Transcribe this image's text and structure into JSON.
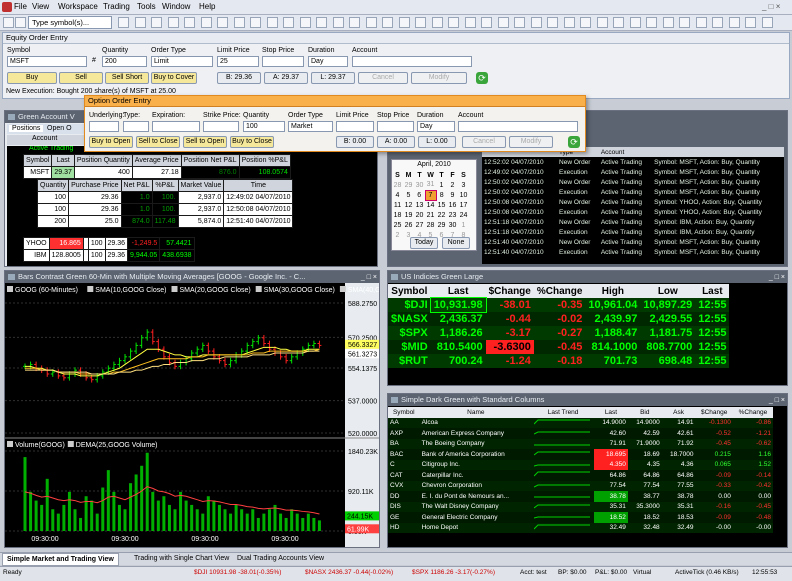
{
  "menu": {
    "items": [
      "File",
      "View",
      "Workspace",
      "Trading",
      "Tools",
      "Window",
      "Help"
    ],
    "symbol_combo": "Type symbol(s)..."
  },
  "equity": {
    "title": "Equity Order Entry",
    "labels": {
      "symbol": "Symbol",
      "quantity": "Quantity",
      "order_type": "Order Type",
      "limit_price": "Limit Price",
      "stop_price": "Stop Price",
      "duration": "Duration",
      "account": "Account"
    },
    "symbol": "MSFT",
    "quantity": "200",
    "order_type": "Limit",
    "limit_price": "25",
    "duration": "Day",
    "buttons": {
      "buy": "Buy",
      "sell": "Sell",
      "sell_short": "Sell Short",
      "buy_to_cover": "Buy to Cover",
      "cancel": "Cancel",
      "modify": "Modify"
    },
    "bid": "B: 29.36",
    "ask": "A: 29.37",
    "last": "L: 29.37",
    "status": "New Execution: Bought 200 share(s) of MSFT at 25.00"
  },
  "option": {
    "title": "Option Order Entry",
    "labels": {
      "underlying": "Underlying:",
      "type": "Type:",
      "expiration": "Expiration:",
      "strike": "Strike Price:",
      "quantity": "Quantity",
      "order_type": "Order Type",
      "limit_price": "Limit Price",
      "stop_price": "Stop Price",
      "duration": "Duration",
      "account": "Account"
    },
    "quantity": "100",
    "order_type": "Market",
    "duration": "Day",
    "buttons": {
      "buy_open": "Buy to Open",
      "sell_close": "Sell to Close",
      "sell_open": "Sell to Open",
      "buy_close": "Buy to Close",
      "cancel": "Cancel",
      "modify": "Modify"
    },
    "bid": "B: 0.00",
    "ask": "A: 0.00",
    "last": "L: 0.00"
  },
  "account": {
    "title": "Green Account V",
    "tabs": [
      "Positions",
      "Open O"
    ],
    "col_account": "Account",
    "active_row": "Active Trading",
    "headers": [
      "Symbol",
      "Last",
      "Position Quantity",
      "Average Price",
      "Position Net P&L",
      "Position %P&L"
    ],
    "msft": [
      "MSFT",
      "29.37",
      "400",
      "27.18",
      "876.0",
      "108.0574"
    ],
    "sub_headers": [
      "Quantity",
      "Purchase Price",
      "Net P&L",
      "%P&L",
      "Market Value",
      "Time"
    ],
    "sub_rows": [
      [
        "100",
        "29.36",
        "1.0",
        "100.",
        "2,937.0",
        "12:49:02 04/07/2010"
      ],
      [
        "100",
        "29.36",
        "1.0",
        "100.",
        "2,937.0",
        "12:50:08 04/07/2010"
      ],
      [
        "200",
        "25.0",
        "874.0",
        "117.48",
        "5,874.0",
        "12:51:40 04/07/2010"
      ]
    ],
    "yhoo": [
      "YHOO",
      "16.865",
      "",
      "100",
      "29.36",
      "-1,249.5",
      "57.4421"
    ],
    "ibm": [
      "IBM",
      "128.8005",
      "",
      "100",
      "29.36",
      "9,944.05",
      "438.6938"
    ]
  },
  "calendar": {
    "month": "April, 2010",
    "days": [
      "S",
      "M",
      "T",
      "W",
      "T",
      "F",
      "S"
    ],
    "weeks": [
      [
        "28",
        "29",
        "30",
        "31",
        "1",
        "2",
        "3"
      ],
      [
        "4",
        "5",
        "6",
        "7",
        "8",
        "9",
        "10"
      ],
      [
        "11",
        "12",
        "13",
        "14",
        "15",
        "16",
        "17"
      ],
      [
        "18",
        "19",
        "20",
        "21",
        "22",
        "23",
        "24"
      ],
      [
        "25",
        "26",
        "27",
        "28",
        "29",
        "30",
        "1"
      ],
      [
        "2",
        "3",
        "4",
        "5",
        "6",
        "7",
        "8"
      ]
    ],
    "today": "Today",
    "none": "None"
  },
  "messages": {
    "headers": [
      "",
      "Type",
      "Account",
      ""
    ],
    "rows": [
      [
        "12:52:02 04/07/2010",
        "New Order",
        "Active Trading",
        "Symbol: MSFT, Action: Buy, Quantity"
      ],
      [
        "12:49:02 04/07/2010",
        "Execution",
        "Active Trading",
        "Symbol: MSFT, Action: Buy, Quantity"
      ],
      [
        "12:50:02 04/07/2010",
        "New Order",
        "Active Trading",
        "Symbol: MSFT, Action: Buy, Quantity"
      ],
      [
        "12:50:02 04/07/2010",
        "Execution",
        "Active Trading",
        "Symbol: MSFT, Action: Buy, Quantity"
      ],
      [
        "12:50:08 04/07/2010",
        "New Order",
        "Active Trading",
        "Symbol: YHOO, Action: Buy, Quantity"
      ],
      [
        "12:50:08 04/07/2010",
        "Execution",
        "Active Trading",
        "Symbol: YHOO, Action: Buy, Quantity"
      ],
      [
        "12:51:18 04/07/2010",
        "New Order",
        "Active Trading",
        "Symbol: IBM, Action: Buy, Quantity"
      ],
      [
        "12:51:18 04/07/2010",
        "Execution",
        "Active Trading",
        "Symbol: IBM, Action: Buy, Quantity"
      ],
      [
        "12:51:40 04/07/2010",
        "New Order",
        "Active Trading",
        "Symbol: MSFT, Action: Buy, Quantity"
      ],
      [
        "12:51:40 04/07/2010",
        "Execution",
        "Active Trading",
        "Symbol: MSFT, Action: Buy, Quantity"
      ]
    ]
  },
  "chart": {
    "title": "Bars Contrast Green 60-Min with Multiple Moving Averages [GOOG - Google Inc. - C...",
    "legend": [
      "GOOG (60-Minutes)",
      "SMA(10,GOOG Close)",
      "SMA(20,GOOG Close)",
      "SMA(30,GOOG Close)",
      "SMA(40,G"
    ],
    "price_ticks": [
      "588.2750",
      "570.2500",
      "554.1375",
      "537.0000",
      "520.0000"
    ],
    "price_labels": [
      "566.3327",
      "561.3273"
    ],
    "vol_legend": [
      "Volume(GOOG)",
      "DEMA(25,GOOG Volume)"
    ],
    "vol_ticks": [
      "1840.23K",
      "920.11K",
      "0.00K"
    ],
    "vol_labels": [
      "244.15K",
      "61.99K"
    ],
    "time_labels": [
      "09:30:00",
      "09:30:00",
      "09:30:00",
      "09:30:00"
    ]
  },
  "chart_data": {
    "type": "bar",
    "title": "Bars Contrast Green 60-Min with Multiple Moving Averages [GOOG - Google Inc. - C...",
    "xlabel": "",
    "ylabel": "",
    "ylim": [
      520,
      588.275
    ],
    "x": [
      "09:30:00",
      "09:30:00",
      "09:30:00",
      "09:30:00"
    ],
    "series": [
      {
        "name": "GOOG (60-Minutes)",
        "values": [
          555,
          556,
          554,
          553,
          551,
          552,
          550,
          549,
          551,
          553,
          551,
          549,
          548,
          550,
          552,
          554,
          556,
          558,
          560,
          563,
          566,
          570,
          573,
          568,
          564,
          560,
          557,
          555,
          557,
          559,
          562,
          564,
          566,
          563,
          560,
          558,
          556,
          558,
          561,
          563,
          566,
          568,
          570,
          567,
          564,
          562,
          560,
          558,
          560,
          562,
          564,
          566,
          567,
          566
        ]
      },
      {
        "name": "SMA(10,GOOG Close)",
        "values": [
          555,
          555,
          554,
          554,
          553,
          553,
          552,
          551,
          551,
          551,
          550,
          550,
          550,
          550,
          551,
          552,
          553,
          554,
          556,
          558,
          560,
          562,
          564,
          564,
          564,
          563,
          562,
          561,
          561,
          560,
          560,
          560,
          561,
          561,
          561,
          561,
          561,
          561,
          561,
          561,
          562,
          563,
          564,
          565,
          565,
          565,
          564,
          564,
          563,
          563,
          563,
          564,
          564,
          564
        ]
      },
      {
        "name": "SMA(20,GOOG Close)",
        "values": [
          554,
          554,
          554,
          553,
          553,
          553,
          552,
          552,
          552,
          552,
          551,
          551,
          551,
          551,
          551,
          551,
          552,
          552,
          553,
          554,
          555,
          556,
          557,
          558,
          559,
          559,
          559,
          559,
          559,
          559,
          560,
          560,
          560,
          561,
          561,
          561,
          561,
          561,
          561,
          561,
          561,
          562,
          562,
          562,
          563,
          563,
          563,
          563,
          563,
          563,
          563,
          563,
          563,
          564
        ]
      },
      {
        "name": "SMA(30,GOOG Close)",
        "values": [
          553,
          553,
          553,
          553,
          553,
          553,
          552,
          552,
          552,
          552,
          552,
          552,
          551,
          551,
          551,
          551,
          551,
          552,
          552,
          552,
          553,
          553,
          554,
          555,
          555,
          556,
          556,
          557,
          557,
          557,
          558,
          558,
          558,
          559,
          559,
          559,
          560,
          560,
          560,
          560,
          560,
          561,
          561,
          561,
          561,
          562,
          562,
          562,
          562,
          562,
          562,
          563,
          563,
          563
        ]
      },
      {
        "name": "Volume(GOOG)",
        "values": [
          1700,
          900,
          700,
          600,
          1200,
          500,
          400,
          600,
          900,
          500,
          300,
          800,
          700,
          400,
          1000,
          1400,
          900,
          600,
          500,
          1100,
          1300,
          1500,
          1800,
          900,
          700,
          800,
          600,
          500,
          900,
          700,
          600,
          500,
          400,
          800,
          700,
          600,
          500,
          400,
          600,
          500,
          400,
          500,
          300,
          400,
          500,
          600,
          400,
          300,
          500,
          400,
          300,
          400,
          300,
          244
        ]
      },
      {
        "name": "DEMA(25,GOOG Volume)",
        "values": [
          900,
          870,
          820,
          780,
          800,
          760,
          720,
          700,
          720,
          700,
          660,
          680,
          680,
          650,
          700,
          780,
          800,
          760,
          720,
          780,
          840,
          920,
          1020,
          980,
          920,
          900,
          860,
          800,
          820,
          800,
          760,
          720,
          680,
          700,
          690,
          670,
          640,
          610,
          610,
          590,
          560,
          550,
          520,
          510,
          520,
          530,
          510,
          480,
          480,
          470,
          450,
          440,
          420,
          390
        ]
      }
    ]
  },
  "us": {
    "title": "US Indicies Green Large",
    "headers": [
      "Symbol",
      "Last",
      "$Change",
      "%Change",
      "High",
      "Low",
      "Last"
    ],
    "rows": [
      [
        "$DJI",
        "10,931.98",
        "-38.01",
        "-0.35",
        "10,961.04",
        "10,897.29",
        "12:55"
      ],
      [
        "$NASX",
        "2,436.37",
        "-0.44",
        "-0.02",
        "2,439.97",
        "2,429.55",
        "12:55"
      ],
      [
        "$SPX",
        "1,186.26",
        "-3.17",
        "-0.27",
        "1,188.47",
        "1,181.75",
        "12:55"
      ],
      [
        "$MID",
        "810.5400",
        "-3.6300",
        "-0.45",
        "814.1000",
        "808.7700",
        "12:55"
      ],
      [
        "$RUT",
        "700.24",
        "-1.24",
        "-0.18",
        "701.73",
        "698.48",
        "12:55"
      ]
    ]
  },
  "simple": {
    "title": "Simple Dark Green with Standard Columns",
    "headers": [
      "Symbol",
      "Name",
      "Last Trend",
      "Last",
      "Bid",
      "Ask",
      "$Change",
      "%Change"
    ],
    "rows": [
      [
        "AA",
        "Alcoa",
        "",
        "14.9000",
        "14.9000",
        "14.91",
        "-0.1300",
        "-0.86"
      ],
      [
        "AXP",
        "American Express Company",
        "",
        "42.60",
        "42.59",
        "42.61",
        "-0.52",
        "-1.21"
      ],
      [
        "BA",
        "The Boeing Company",
        "",
        "71.91",
        "71.9000",
        "71.92",
        "-0.45",
        "-0.62"
      ],
      [
        "BAC",
        "Bank of America Corporation",
        "",
        "18.695",
        "18.69",
        "18.7000",
        "0.215",
        "1.16"
      ],
      [
        "C",
        "Citigroup Inc.",
        "",
        "4.350",
        "4.35",
        "4.36",
        "0.065",
        "1.52"
      ],
      [
        "CAT",
        "Caterpillar Inc.",
        "",
        "64.86",
        "64.86",
        "64.86",
        "-0.09",
        "-0.14"
      ],
      [
        "CVX",
        "Chevron Corporation",
        "",
        "77.54",
        "77.54",
        "77.55",
        "-0.33",
        "-0.42"
      ],
      [
        "DD",
        "E. I. du Pont de Nemours an...",
        "",
        "38.78",
        "38.77",
        "38.78",
        "0.00",
        "0.00"
      ],
      [
        "DIS",
        "The Walt Disney Company",
        "",
        "35.31",
        "35.3000",
        "35.31",
        "-0.16",
        "-0.45"
      ],
      [
        "GE",
        "General Electric Company",
        "",
        "18.52",
        "18.52",
        "18.53",
        "-0.09",
        "-0.48"
      ],
      [
        "HD",
        "Home Depot",
        "",
        "32.49",
        "32.48",
        "32.49",
        "-0.00",
        "-0.00"
      ]
    ]
  },
  "tabs": [
    "Simple Market and Trading View",
    "Trading with Single Chart View",
    "Dual Trading Accounts View"
  ],
  "status": {
    "ready": "Ready",
    "quotes": [
      "$DJI 10931.98 -38.01(-0.35%)",
      "$NASX 2436.37 -0.44(-0.02%)",
      "$SPX 1186.26 -3.17(-0.27%)"
    ],
    "acct": "Acct: test",
    "bp": "BP: $0.00",
    "pl": "P&L: $0.00",
    "virtual": "Virtual",
    "feed": "ActiveTick (0.46 KB/s)",
    "time": "12:55:53"
  },
  "colors": {
    "green": "#00d000",
    "red": "#ff2020",
    "lime": "#00ff00",
    "orange_title": "#f9b04a"
  }
}
